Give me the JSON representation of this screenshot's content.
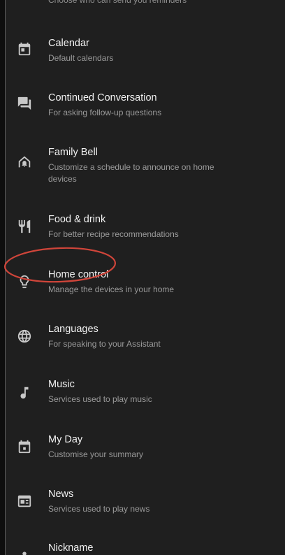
{
  "top_partial_text": "Choose who can send you reminders",
  "items": [
    {
      "title": "Calendar",
      "subtitle": "Default calendars",
      "icon": "calendar-icon"
    },
    {
      "title": "Continued Conversation",
      "subtitle": "For asking follow-up questions",
      "icon": "chat-icon"
    },
    {
      "title": "Family Bell",
      "subtitle": "Customize a schedule to announce on home devices",
      "icon": "home-bell-icon"
    },
    {
      "title": "Food & drink",
      "subtitle": "For better recipe recommendations",
      "icon": "fork-knife-icon"
    },
    {
      "title": "Home control",
      "subtitle": "Manage the devices in your home",
      "icon": "lightbulb-icon"
    },
    {
      "title": "Languages",
      "subtitle": "For speaking to your Assistant",
      "icon": "globe-icon"
    },
    {
      "title": "Music",
      "subtitle": "Services used to play music",
      "icon": "music-note-icon"
    },
    {
      "title": "My Day",
      "subtitle": "Customise your summary",
      "icon": "calendar-today-icon"
    },
    {
      "title": "News",
      "subtitle": "Services used to play news",
      "icon": "news-icon"
    },
    {
      "title": "Nickname",
      "subtitle": "",
      "icon": "person-icon"
    }
  ],
  "colors": {
    "background": "#1f1f1f",
    "title": "#f2f2f2",
    "subtitle": "#9a9a9a",
    "icon": "#c8c8c8",
    "annotation": "#d0453a"
  }
}
